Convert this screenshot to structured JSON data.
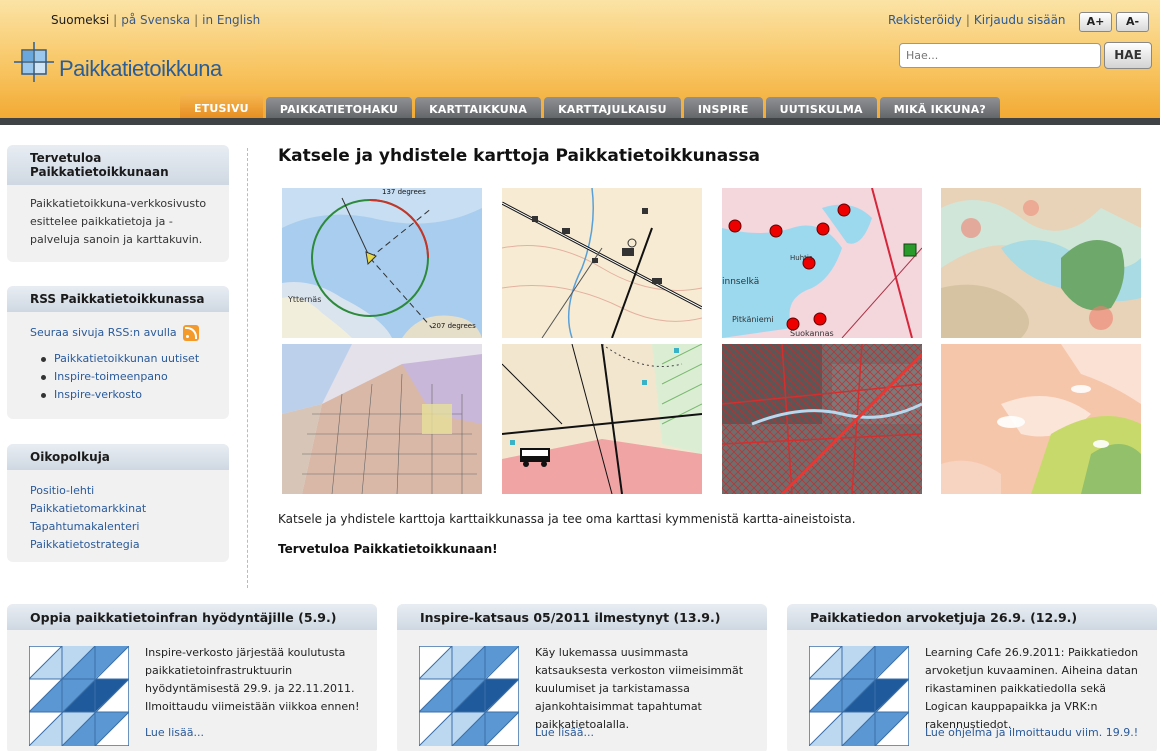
{
  "header": {
    "languages": [
      "Suomeksi",
      "på Svenska",
      "in English"
    ],
    "register": "Rekisteröidy",
    "login": "Kirjaudu sisään",
    "font_increase": "A+",
    "font_decrease": "A-",
    "logo_text": "Paikkatietoikkuna",
    "search_placeholder": "Hae...",
    "search_button": "HAE",
    "nav": [
      "ETUSIVU",
      "PAIKKATIETOHAKU",
      "KARTTAIKKUNA",
      "KARTTAJULKAISU",
      "INSPIRE",
      "UUTISKULMA",
      "MIKÄ IKKUNA?"
    ]
  },
  "sidebar": {
    "welcome_title": "Tervetuloa Paikkatietoikkunaan",
    "welcome_text": "Paikkatietoikkuna-verkkosivusto esittelee paikkatietoja ja -palveluja sanoin ja karttakuvin.",
    "rss_title": "RSS Paikkatietoikkunassa",
    "rss_follow": "Seuraa sivuja RSS:n avulla",
    "rss_items": [
      "Paikkatietoikkunan uutiset",
      "Inspire-toimeenpano",
      "Inspire-verkosto"
    ],
    "shortcuts_title": "Oikopolkuja",
    "shortcuts": [
      "Positio-lehti",
      "Paikkatietomarkkinat",
      "Tapahtumakalenteri",
      "Paikkatietostrategia"
    ]
  },
  "main": {
    "title": "Katsele ja yhdistele karttoja Paikkatietoikkunassa",
    "description": "Katsele ja yhdistele karttoja karttaikkunassa ja tee oma karttasi kymmenistä kartta-aineistoista.",
    "welcome": "Tervetuloa Paikkatietoikkunaan!",
    "map_labels": {
      "degrees_top": "137 degrees",
      "degrees_bottom": "207 degrees",
      "place_ytternas": "Ytternäs",
      "place_huhtis": "Huhtis",
      "place_selka": "innselkä",
      "place_pitkaniemi": "Pitkäniemi",
      "place_suokannas": "Suokannas"
    }
  },
  "news": [
    {
      "title": "Oppia paikkatietoinfran hyödyntäjille (5.9.)",
      "text": "Inspire-verkosto järjestää koulutusta paikkatietoinfrastruktuurin hyödyntämisestä 29.9. ja 22.11.2011. Ilmoittaudu viimeistään viikkoa ennen!",
      "more": "Lue lisää..."
    },
    {
      "title": "Inspire-katsaus 05/2011 ilmestynyt (13.9.)",
      "text": "Käy lukemassa uusimmasta katsauksesta verkoston viimeisimmät kuulumiset ja tarkistamassa ajankohtaisimmat tapahtumat paikkatietoalalla.",
      "more": "Lue lisää..."
    },
    {
      "title": "Paikkatiedon arvoketjuja 26.9. (12.9.)",
      "text": "Learning Cafe 26.9.2011: Paikkatiedon arvoketjun kuvaaminen. Aiheina datan rikastaminen paikkatiedolla sekä Logican kauppapaikka ja VRK:n rakennustiedot.",
      "more": "Lue ohjelma ja ilmoittaudu viim. 19.9.!"
    }
  ]
}
